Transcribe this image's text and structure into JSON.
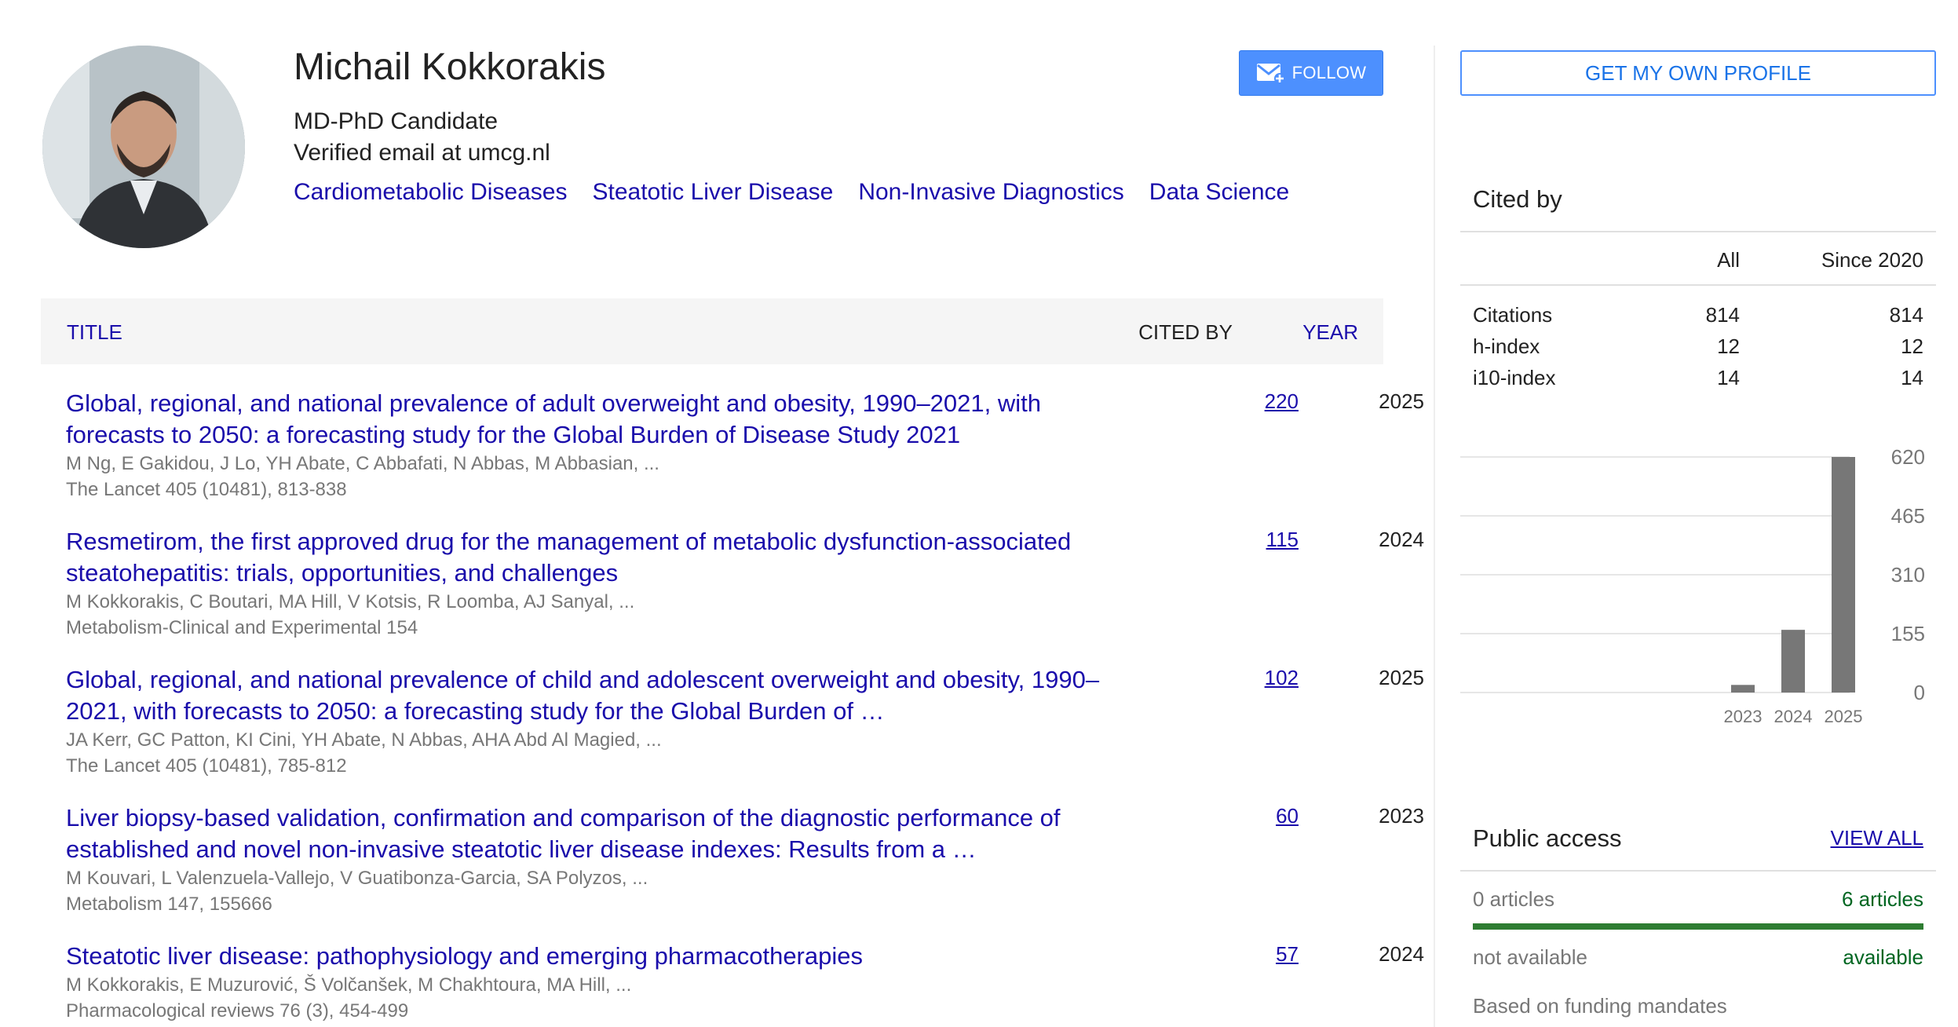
{
  "profile": {
    "name": "Michail Kokkorakis",
    "affiliation": "MD-PhD Candidate",
    "email": "Verified email at umcg.nl",
    "interests": [
      "Cardiometabolic Diseases",
      "Steatotic Liver Disease",
      "Non-Invasive Diagnostics",
      "Data Science"
    ],
    "follow_label": "FOLLOW"
  },
  "table": {
    "col_title": "TITLE",
    "col_cited": "CITED BY",
    "col_year": "YEAR"
  },
  "articles": [
    {
      "title": "Global, regional, and national prevalence of adult overweight and obesity, 1990–2021, with forecasts to 2050: a forecasting study for the Global Burden of Disease Study 2021",
      "authors": "M Ng, E Gakidou, J Lo, YH Abate, C Abbafati, N Abbas, M Abbasian, ...",
      "venue": "The Lancet 405 (10481), 813-838",
      "cited": "220",
      "year": "2025"
    },
    {
      "title": "Resmetirom, the first approved drug for the management of metabolic dysfunction-associated steatohepatitis: trials, opportunities, and challenges",
      "authors": "M Kokkorakis, C Boutari, MA Hill, V Kotsis, R Loomba, AJ Sanyal, ...",
      "venue": "Metabolism-Clinical and Experimental 154",
      "cited": "115",
      "year": "2024"
    },
    {
      "title": "Global, regional, and national prevalence of child and adolescent overweight and obesity, 1990–2021, with forecasts to 2050: a forecasting study for the Global Burden of …",
      "authors": "JA Kerr, GC Patton, KI Cini, YH Abate, N Abbas, AHA Abd Al Magied, ...",
      "venue": "The Lancet 405 (10481), 785-812",
      "cited": "102",
      "year": "2025"
    },
    {
      "title": "Liver biopsy-based validation, confirmation and comparison of the diagnostic performance of established and novel non-invasive steatotic liver disease indexes: Results from a …",
      "authors": "M Kouvari, L Valenzuela-Vallejo, V Guatibonza-Garcia, SA Polyzos, ...",
      "venue": "Metabolism 147, 155666",
      "cited": "60",
      "year": "2023"
    },
    {
      "title": "Steatotic liver disease: pathophysiology and emerging pharmacotherapies",
      "authors": "M Kokkorakis, E Muzurović, Š Volčanšek, M Chakhtoura, MA Hill, ...",
      "venue": "Pharmacological reviews 76 (3), 454-499",
      "cited": "57",
      "year": "2024"
    }
  ],
  "sidebar": {
    "own_profile_label": "GET MY OWN PROFILE",
    "cited_by": {
      "title": "Cited by",
      "col_all": "All",
      "col_since": "Since 2020",
      "rows": [
        {
          "label": "Citations",
          "all": "814",
          "since": "814"
        },
        {
          "label": "h-index",
          "all": "12",
          "since": "12"
        },
        {
          "label": "i10-index",
          "all": "14",
          "since": "14"
        }
      ]
    },
    "public_access": {
      "title": "Public access",
      "view_all": "VIEW ALL",
      "left_count": "0 articles",
      "right_count": "6 articles",
      "left_status": "not available",
      "right_status": "available",
      "note": "Based on funding mandates",
      "available_fraction": 1.0
    }
  },
  "colors": {
    "link": "#1a0dab",
    "button": "#4d90fe",
    "bar": "#777777",
    "available": "#2e7d32"
  },
  "chart_data": {
    "type": "bar",
    "categories": [
      "2023",
      "2024",
      "2025"
    ],
    "values": [
      20,
      165,
      620
    ],
    "yticks": [
      "620",
      "465",
      "310",
      "155",
      "0"
    ],
    "ylim": [
      0,
      620
    ],
    "grid": true
  }
}
